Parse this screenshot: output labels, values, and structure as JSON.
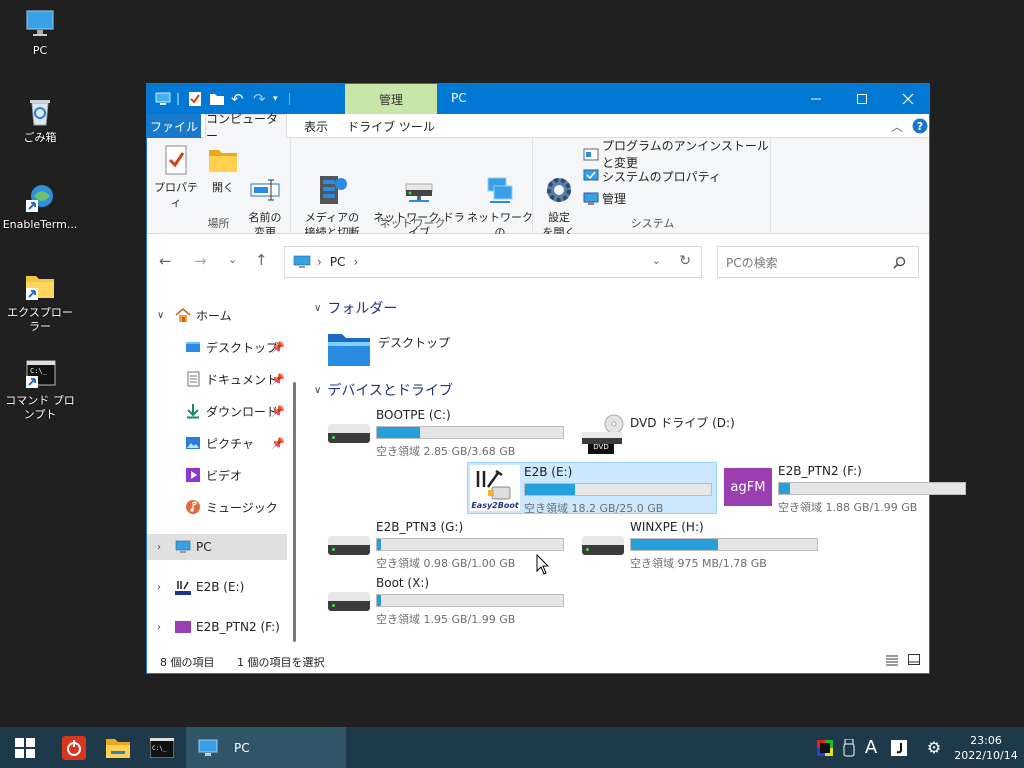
{
  "desktop": {
    "icons": [
      {
        "label": "PC"
      },
      {
        "label": "ごみ箱"
      },
      {
        "label": "EnableTerm..."
      },
      {
        "label": "エクスプローラー"
      },
      {
        "label": "コマンド プロンプト"
      }
    ]
  },
  "window": {
    "title": "PC",
    "context_tab": "管理",
    "tabs": [
      "ファイル",
      "コンピューター",
      "表示",
      "ドライブ ツール"
    ],
    "ribbon": {
      "groups": [
        {
          "label": "場所",
          "buttons": [
            "プロパティ",
            "開く",
            "名前の\n変更"
          ]
        },
        {
          "label": "ネットワーク",
          "buttons": [
            "メディアの\n接続と切断",
            "ネットワーク ドライブ\nの割り当て",
            "ネットワークの\n場所の追加"
          ]
        },
        {
          "label": "システム",
          "big": "設定\nを開く",
          "small": [
            "プログラムのアンインストールと変更",
            "システムのプロパティ",
            "管理"
          ]
        }
      ],
      "dropdown_mark": "▾"
    },
    "address": {
      "path": "PC",
      "sep": "›"
    },
    "search": {
      "placeholder": "PCの検索"
    },
    "nav": {
      "home": "ホーム",
      "quick": [
        {
          "label": "デスクトップ",
          "pinned": true
        },
        {
          "label": "ドキュメント",
          "pinned": true
        },
        {
          "label": "ダウンロード",
          "pinned": true
        },
        {
          "label": "ピクチャ",
          "pinned": true
        },
        {
          "label": "ビデオ",
          "pinned": false
        },
        {
          "label": "ミュージック",
          "pinned": false
        }
      ],
      "pc": "PC",
      "drives": [
        "E2B (E:)",
        "E2B_PTN2 (F:)"
      ]
    },
    "content": {
      "folders_header": "フォルダー",
      "folders": [
        {
          "label": "デスクトップ"
        }
      ],
      "drives_header": "デバイスとドライブ",
      "drives": [
        {
          "name": "BOOTPE (C:)",
          "free": "空き領域 2.85 GB/3.68 GB",
          "used_fraction": 0.23,
          "icon": "hdd-icon"
        },
        {
          "name": "DVD ドライブ (D:)",
          "free": "",
          "used_fraction": null,
          "icon": "dvd-icon",
          "badge": "DVD"
        },
        {
          "name": "E2B (E:)",
          "free": "空き領域 18.2 GB/25.0 GB",
          "used_fraction": 0.27,
          "icon": "easy2boot-icon",
          "selected": true,
          "badge": "Easy2Boot"
        },
        {
          "name": "E2B_PTN2 (F:)",
          "free": "空き領域 1.88 GB/1.99 GB",
          "used_fraction": 0.06,
          "icon": "agfm-icon",
          "badge": "agFM"
        },
        {
          "name": "E2B_PTN3 (G:)",
          "free": "空き領域 0.98 GB/1.00 GB",
          "used_fraction": 0.02,
          "icon": "hdd-icon"
        },
        {
          "name": "WINXPE (H:)",
          "free": "空き領域 975 MB/1.78 GB",
          "used_fraction": 0.47,
          "icon": "hdd-icon"
        },
        {
          "name": "Boot (X:)",
          "free": "空き領域 1.95 GB/1.99 GB",
          "used_fraction": 0.02,
          "icon": "hdd-icon"
        }
      ]
    },
    "status": {
      "items": "8 個の項目",
      "selected": "1 個の項目を選択"
    }
  },
  "taskbar": {
    "active": "PC",
    "tray_letter": "A",
    "time": "23:06",
    "date": "2022/10/14"
  },
  "colors": {
    "accent": "#0078d4",
    "bar_fill": "#26a0da",
    "taskbar": "#1e3a4a"
  }
}
